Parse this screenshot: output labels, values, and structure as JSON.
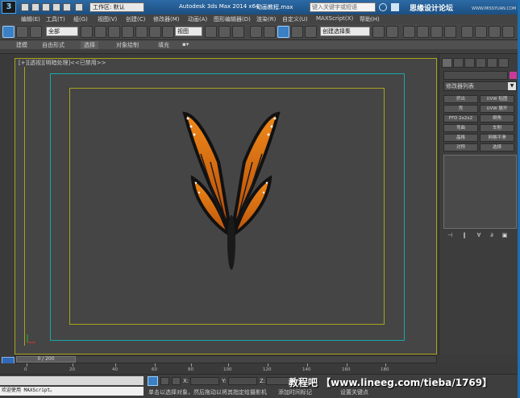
{
  "titlebar": {
    "workspace_label": "工作区: 默认",
    "app_title": "Autodesk 3ds Max  2014 x64",
    "file_title": "动画教程.max",
    "search_placeholder": "键入关键字或短语",
    "watermark": "思缘设计论坛",
    "watermark_url": "WWW.MISSYUAN.COM"
  },
  "menubar": {
    "items": [
      "编辑(E)",
      "工具(T)",
      "组(G)",
      "视图(V)",
      "创建(C)",
      "修改器(M)",
      "动画(A)",
      "图形编辑器(D)",
      "渲染(R)",
      "自定义(U)",
      "MAXScript(X)",
      "帮助(H)"
    ]
  },
  "toolbar": {
    "selection_filter": "全部",
    "reference_coord": "视图",
    "named_selection": "创建选择集"
  },
  "ribbon": {
    "tabs": [
      "建模",
      "自由形式",
      "选择",
      "对象绘制",
      "填充"
    ],
    "active_tab": "选择"
  },
  "viewport": {
    "label": "[+][透视][明暗处理]",
    "label2": "<<已禁用>>"
  },
  "command_panel": {
    "modifier_list": "修改器列表",
    "buttons": [
      [
        "挤出",
        "UVW 贴图"
      ],
      [
        "壳",
        "UVW 展开"
      ],
      [
        "FFD 2x2x2",
        "倒角"
      ],
      [
        "弯曲",
        "车削"
      ],
      [
        "晶格",
        "网格平滑"
      ],
      [
        "对称",
        "选择"
      ]
    ],
    "stack_tools": [
      "⊣",
      "‖",
      "∀",
      "∂",
      "▣"
    ]
  },
  "timeline": {
    "frame_display": "0 / 200",
    "ticks": [
      "0",
      "20",
      "40",
      "60",
      "80",
      "100",
      "120",
      "140",
      "160",
      "180"
    ]
  },
  "statusbar": {
    "maxscript": "欢迎使用 MAXScript。",
    "prompt": "单击以选择对象，然后拖动以将其指定给摄影机",
    "add_time_tag": "添加时间标记",
    "key_mode": "设置关键点",
    "coord_labels": [
      "X:",
      "Y:",
      "Z:"
    ],
    "watermark": "教程吧 【www.lineeg.com/tieba/1769】"
  },
  "colors": {
    "accent": "#3b7fc4",
    "safe_frame": "#1ba7a7",
    "viewport_frame": "#a8a31b",
    "object_color": "#c83a9a"
  }
}
